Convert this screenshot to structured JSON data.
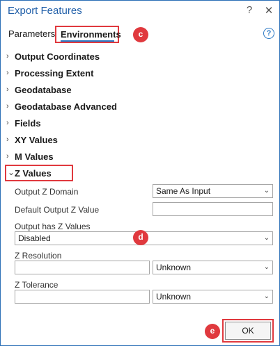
{
  "window": {
    "title": "Export Features",
    "help_glyph": "?",
    "close_glyph": "✕"
  },
  "tabs": {
    "parameters": "Parameters",
    "environments": "Environments",
    "help_glyph": "?"
  },
  "sections": [
    {
      "label": "Output Coordinates",
      "expanded": false
    },
    {
      "label": "Processing Extent",
      "expanded": false
    },
    {
      "label": "Geodatabase",
      "expanded": false
    },
    {
      "label": "Geodatabase Advanced",
      "expanded": false
    },
    {
      "label": "Fields",
      "expanded": false
    },
    {
      "label": "XY Values",
      "expanded": false
    },
    {
      "label": "M Values",
      "expanded": false
    },
    {
      "label": "Z Values",
      "expanded": true
    }
  ],
  "chevrons": {
    "collapsed": "›",
    "expanded": "⌄"
  },
  "z_values": {
    "output_z_domain": {
      "label": "Output Z Domain",
      "value": "Same As Input"
    },
    "default_output_z_value": {
      "label": "Default Output Z Value",
      "value": ""
    },
    "output_has_z_values": {
      "label": "Output has Z Values",
      "value": "Disabled"
    },
    "z_resolution": {
      "label": "Z Resolution",
      "value": "",
      "unit": "Unknown"
    },
    "z_tolerance": {
      "label": "Z Tolerance",
      "value": "",
      "unit": "Unknown"
    }
  },
  "badges": {
    "c": "c",
    "d": "d",
    "e": "e"
  },
  "footer": {
    "ok_label": "OK"
  },
  "colors": {
    "accent": "#2b78c4",
    "title": "#1f5ea8",
    "highlight": "#e0393e",
    "frame": "#2b6fb6"
  },
  "icons": {
    "dropdown": "chevron-down-icon"
  }
}
